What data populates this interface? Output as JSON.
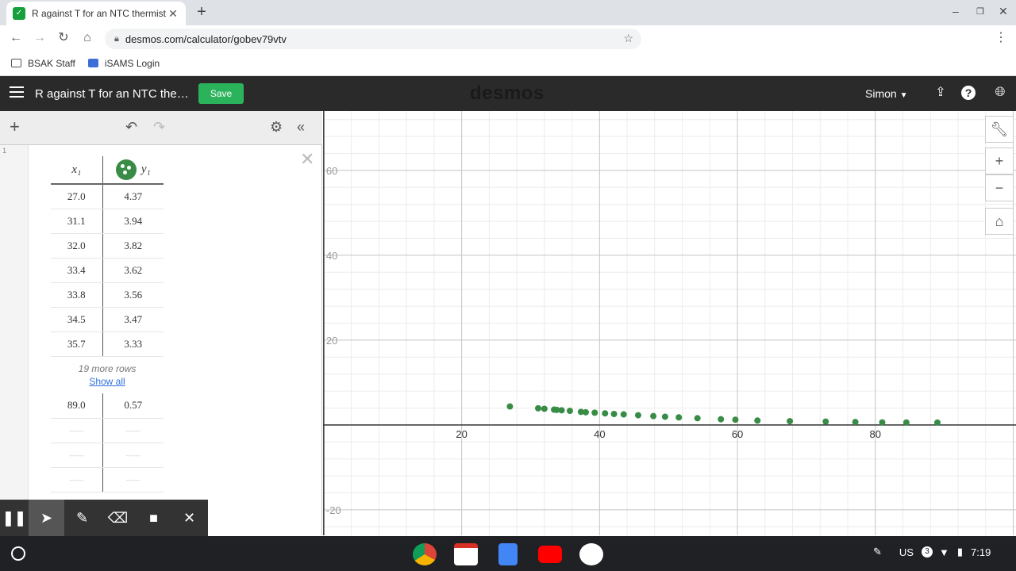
{
  "browser": {
    "tab_title": "R against T for an NTC thermist",
    "url": "desmos.com/calculator/gobev79vtv",
    "bookmarks": [
      {
        "label": "BSAK Staff"
      },
      {
        "label": "iSAMS Login"
      }
    ]
  },
  "desmos": {
    "graph_title": "R against T for an NTC the…",
    "save_label": "Save",
    "logo": "desmos",
    "user_label": "Simon"
  },
  "expression": {
    "row_number": "1",
    "col_x": "x₁",
    "col_y": "y₁",
    "rows": [
      {
        "x": "27.0",
        "y": "4.37"
      },
      {
        "x": "31.1",
        "y": "3.94"
      },
      {
        "x": "32.0",
        "y": "3.82"
      },
      {
        "x": "33.4",
        "y": "3.62"
      },
      {
        "x": "33.8",
        "y": "3.56"
      },
      {
        "x": "34.5",
        "y": "3.47"
      },
      {
        "x": "35.7",
        "y": "3.33"
      }
    ],
    "more_rows": "19 more rows",
    "show_all": "Show all",
    "last_row": {
      "x": "89.0",
      "y": "0.57"
    },
    "empty_placeholder": "------"
  },
  "graph": {
    "x_ticks": [
      "20",
      "40",
      "60",
      "80"
    ],
    "y_ticks": [
      "60",
      "40",
      "20",
      "-20"
    ]
  },
  "chart_data": {
    "type": "scatter",
    "xlim": [
      -0.1,
      100.4
    ],
    "ylim": [
      -26,
      74
    ],
    "grid": true,
    "x_tick_values": [
      20,
      40,
      60,
      80
    ],
    "y_tick_values": [
      60,
      40,
      20,
      -20
    ],
    "point_color": "#388c46",
    "points": [
      [
        27.0,
        4.37
      ],
      [
        31.1,
        3.94
      ],
      [
        32.0,
        3.82
      ],
      [
        33.4,
        3.62
      ],
      [
        33.8,
        3.56
      ],
      [
        34.5,
        3.47
      ],
      [
        35.7,
        3.33
      ],
      [
        37.3,
        3.1
      ],
      [
        38.0,
        3.0
      ],
      [
        39.3,
        2.9
      ],
      [
        40.8,
        2.75
      ],
      [
        42.1,
        2.6
      ],
      [
        43.5,
        2.5
      ],
      [
        45.6,
        2.3
      ],
      [
        47.8,
        2.1
      ],
      [
        49.5,
        1.95
      ],
      [
        51.5,
        1.8
      ],
      [
        54.2,
        1.6
      ],
      [
        57.6,
        1.35
      ],
      [
        59.7,
        1.25
      ],
      [
        62.9,
        1.05
      ],
      [
        67.6,
        0.9
      ],
      [
        72.8,
        0.8
      ],
      [
        77.1,
        0.7
      ],
      [
        81.0,
        0.62
      ],
      [
        84.5,
        0.6
      ],
      [
        89.0,
        0.57
      ]
    ]
  },
  "system": {
    "locale": "US",
    "notif_count": "3",
    "time": "7:19"
  },
  "colors": {
    "save_green": "#2bb35c",
    "point_green": "#388c46",
    "header_bg": "#2a2a2a"
  }
}
